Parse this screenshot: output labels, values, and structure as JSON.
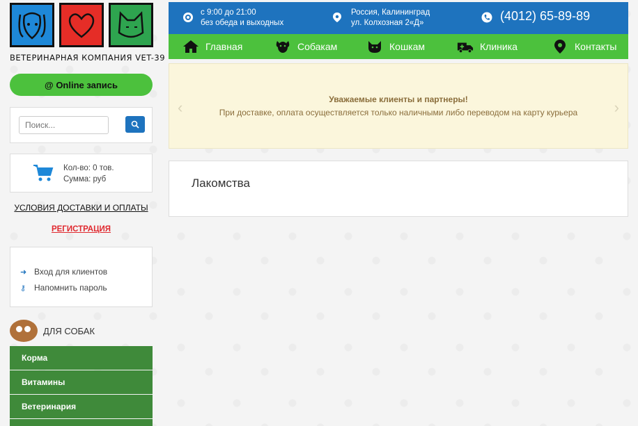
{
  "logo": {
    "caption": "ВЕТЕРИНАРНАЯ КОМПАНИЯ VET-39"
  },
  "online_button": "@ Online запись",
  "search": {
    "placeholder": "Поиск..."
  },
  "cart": {
    "count": "Кол-во: 0 тов.",
    "sum": "Сумма:  руб"
  },
  "delivery_link": "УСЛОВИЯ ДОСТАВКИ И ОПЛАТЫ",
  "register_link": "РЕГИСТРАЦИЯ",
  "login": {
    "enter": "Вход для клиентов",
    "remind": "Напомнить пароль"
  },
  "dogs_section": {
    "title": "ДЛЯ СОБАК",
    "items": [
      "Корма",
      "Витамины",
      "Ветеринария"
    ]
  },
  "topbar": {
    "hours_line1": "с 9:00 до 21:00",
    "hours_line2": "без обеда и выходных",
    "address_line1": "Россия, Калининград",
    "address_line2": "ул. Колхозная 2«Д»",
    "phone": "(4012) 65-89-89"
  },
  "nav": {
    "items": [
      "Главная",
      "Собакам",
      "Кошкам",
      "Клиника",
      "Контакты"
    ]
  },
  "banner": {
    "title": "Уважаемые клиенты и партнеры!",
    "text": "При доставке, оплата осуществляется только наличными либо переводом на карту курьера"
  },
  "content": {
    "heading": "Лакомства"
  },
  "colors": {
    "blue": "#1e73be",
    "green": "#4cc13d",
    "dark_green": "#3f8a3a",
    "red": "#e0282e",
    "banner_bg": "#fbf6dc"
  }
}
